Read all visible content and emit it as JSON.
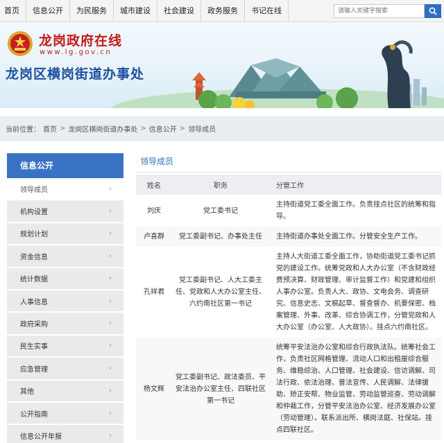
{
  "nav": {
    "items": [
      "首页",
      "信息公开",
      "为民服务",
      "城市建设",
      "社会建设",
      "政务服务",
      "书记在线"
    ],
    "search_placeholder": "请输入关键字搜索"
  },
  "banner": {
    "site_name": "龙岗政府在线",
    "site_url": "www.lg.gov.cn",
    "office_name": "龙岗区横岗街道办事处"
  },
  "breadcrumb": {
    "prefix": "当前位置：",
    "items": [
      "首页",
      "龙岗区横岗街道办事处",
      "信息公开",
      "领导成员"
    ],
    "separator": ">"
  },
  "sidebar": {
    "title": "信息公开",
    "items": [
      {
        "label": "领导成员"
      },
      {
        "label": "机构设置"
      },
      {
        "label": "规划计划"
      },
      {
        "label": "资金信息"
      },
      {
        "label": "统计数据"
      },
      {
        "label": "人事信息"
      },
      {
        "label": "政府采购"
      },
      {
        "label": "民生实事"
      },
      {
        "label": "应急管理"
      },
      {
        "label": "其他"
      },
      {
        "label": "公开指南"
      },
      {
        "label": "信息公开年报"
      }
    ],
    "chevron": "›"
  },
  "main": {
    "section_title": "领导成员",
    "columns": [
      "姓名",
      "职务",
      "分管工作"
    ],
    "rows": [
      {
        "name": "刘庆",
        "post": "党工委书记",
        "duty": "主持街道党工委全面工作。负责挂点社区的统筹和指导。"
      },
      {
        "name": "卢喜群",
        "post": "党工委副书记、办事处主任",
        "duty": "主持街道办事处全面工作。分管安全生产工作。"
      },
      {
        "name": "孔祥君",
        "post": "党工委副书记、人大工委主任、党政和人大办公室主任、六约南社区第一书记",
        "duty": "主持人大街道工委全面工作，协助街道党工委书记抓党的建设工作。统筹党政和人大办公室（不含财政经费预决算、财政管理、审计监督工作）和党建和组织人事办公室。负责人大、政协、文电会务、调查研究、信息史志、文稿起草、督查督办、机要保密、档案管理、外事、改革、综合协调工作，分管党政和人大办公室（办公室、人大政协）。挂点六约南社区。"
      },
      {
        "name": "杨文辉",
        "post": "党工委副书记、政法委员、平安法治办公室主任、四联社区第一书记",
        "duty": "统筹平安法治办公室和综合行政执法队。统筹社会工作，负责社区网格管理、流动人口和出租屋综合服务、维稳综治、人口管理、社会建设、信访调解、司法行政、依法治理、普法宣传、人民调解、法律援助、矫正安帮、物业监管、劳动监管巡查、劳动调解和仲裁工作，分管平安法治办公室、经济发展办公室（劳动管理）。联系派出所、横岗法庭、社保站。挂点四联社区。"
      }
    ]
  }
}
